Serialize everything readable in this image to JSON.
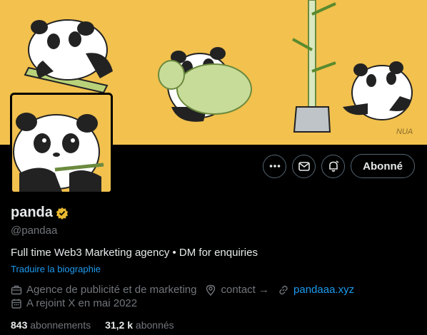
{
  "profile": {
    "display_name": "panda",
    "handle": "@pandaa",
    "bio": "Full time Web3 Marketing agency • DM for enquiries",
    "translate_label": "Traduire la biographie",
    "category": "Agence de publicité et de marketing",
    "location": "contact →",
    "website": "pandaaa.xyz",
    "joined": "A rejoint X en mai 2022",
    "following_count": "843",
    "following_label": "abonnements",
    "followers_count": "31,2 k",
    "followers_label": "abonnés"
  },
  "actions": {
    "follow_label": "Abonné"
  },
  "banner": {
    "signature": "NUA"
  },
  "colors": {
    "banner_bg": "#f2c14e",
    "accent": "#1d9bf0",
    "verified": "#e8b931",
    "muted": "#71767b"
  },
  "icons": [
    "more-icon",
    "message-icon",
    "notification-bell-icon",
    "verified-badge-icon",
    "briefcase-icon",
    "location-icon",
    "link-icon",
    "calendar-icon"
  ]
}
